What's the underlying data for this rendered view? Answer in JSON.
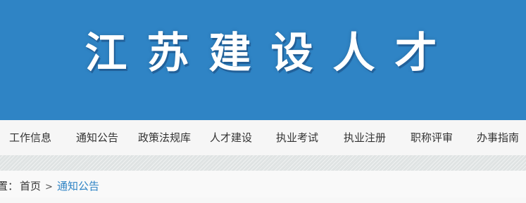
{
  "banner": {
    "title": "江苏建设人才"
  },
  "nav": {
    "items": [
      {
        "label": "工作信息"
      },
      {
        "label": "通知公告"
      },
      {
        "label": "政策法规库"
      },
      {
        "label": "人才建设"
      },
      {
        "label": "执业考试"
      },
      {
        "label": "执业注册"
      },
      {
        "label": "职称评审"
      },
      {
        "label": "办事指南"
      }
    ]
  },
  "breadcrumb": {
    "prefix": "置：",
    "home": "首页",
    "separator": ">",
    "current": "通知公告"
  },
  "colors": {
    "banner_bg": "#2f84c5",
    "link_accent": "#2f84c5",
    "nav_bg": "#f6f6f6"
  }
}
